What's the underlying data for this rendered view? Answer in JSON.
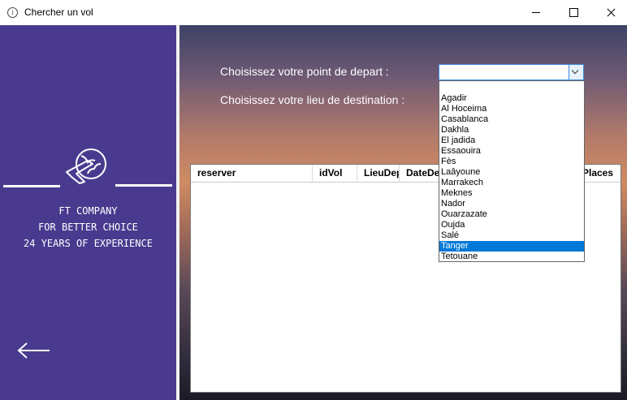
{
  "window": {
    "title": "Chercher un vol"
  },
  "sidebar": {
    "brand_lines": [
      "FT COMPANY",
      "FOR BETTER CHOICE",
      "24 YEARS OF EXPERIENCE"
    ]
  },
  "form": {
    "departure_label": "Choisissez votre point de depart :",
    "destination_label": "Choisissez votre lieu de destination :",
    "departure_value": "",
    "selected_option": "Tanger",
    "options": [
      "Agadir",
      "Al Hoceima",
      "Casablanca",
      "Dakhla",
      "El jadida",
      "Essaouira",
      "Fès",
      "Laâyoune",
      "Marrakech",
      "Meknes",
      "Nador",
      "Ouarzazate",
      "Oujda",
      "Salé",
      "Tanger",
      "Tetouane"
    ]
  },
  "grid": {
    "columns": [
      "reserver",
      "idVol",
      "LieuDep",
      "DateDe",
      "Places"
    ],
    "rows": []
  }
}
